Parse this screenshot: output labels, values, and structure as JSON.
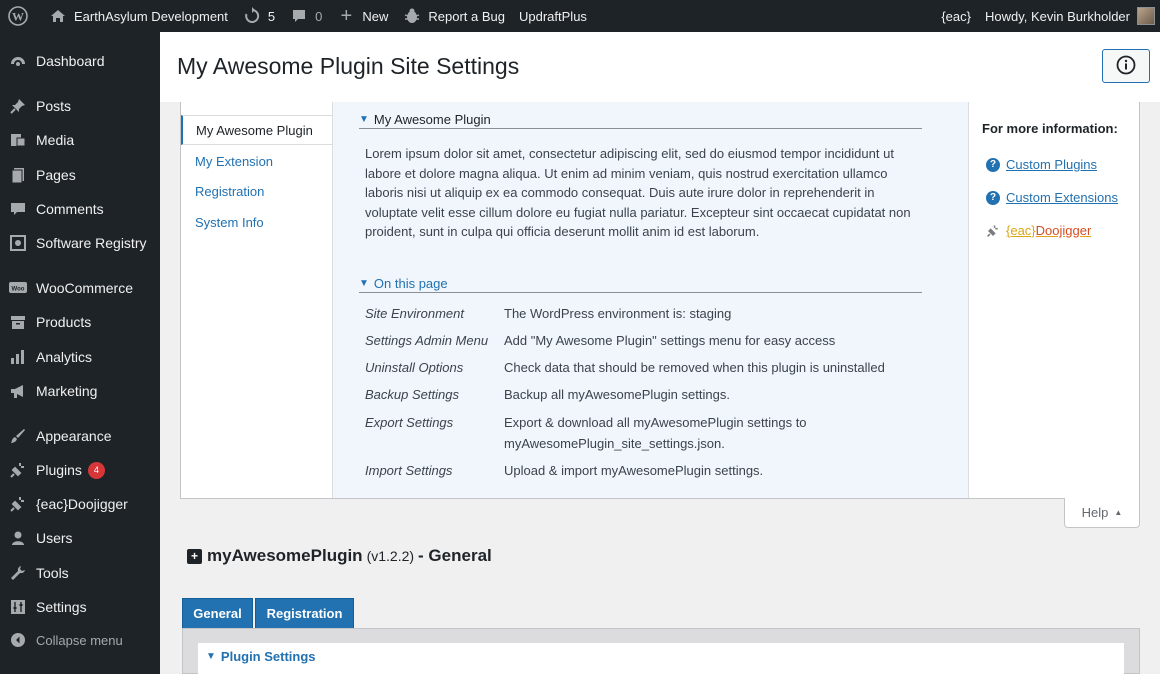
{
  "adminbar": {
    "site_name": "EarthAsylum Development",
    "updates_count": "5",
    "comments_count": "0",
    "new_label": "New",
    "report_bug": "Report a Bug",
    "updraft": "UpdraftPlus",
    "eac_label": "{eac}",
    "howdy": "Howdy, Kevin Burkholder"
  },
  "sidebar": {
    "items": [
      {
        "label": "Dashboard",
        "icon": "dashboard-icon"
      },
      {
        "label": "Posts",
        "icon": "pin-icon"
      },
      {
        "label": "Media",
        "icon": "media-icon"
      },
      {
        "label": "Pages",
        "icon": "pages-icon"
      },
      {
        "label": "Comments",
        "icon": "comment-icon"
      },
      {
        "label": "Software Registry",
        "icon": "registry-icon"
      },
      {
        "label": "WooCommerce",
        "icon": "woo-icon"
      },
      {
        "label": "Products",
        "icon": "archive-icon"
      },
      {
        "label": "Analytics",
        "icon": "chart-bar-icon"
      },
      {
        "label": "Marketing",
        "icon": "megaphone-icon"
      },
      {
        "label": "Appearance",
        "icon": "brush-icon"
      },
      {
        "label": "Plugins",
        "icon": "plug-icon",
        "badge": "4"
      },
      {
        "label": "{eac}Doojigger",
        "icon": "plug-icon"
      },
      {
        "label": "Users",
        "icon": "user-icon"
      },
      {
        "label": "Tools",
        "icon": "wrench-icon"
      },
      {
        "label": "Settings",
        "icon": "sliders-icon"
      }
    ],
    "collapse": "Collapse menu"
  },
  "page": {
    "title": "My Awesome Plugin Site Settings"
  },
  "help": {
    "tabs": [
      "My Awesome Plugin",
      "My Extension",
      "Registration",
      "System Info"
    ],
    "active_tab": "My Awesome Plugin",
    "section_title": "My Awesome Plugin",
    "lorem": "Lorem ipsum dolor sit amet, consectetur adipiscing elit, sed do eiusmod tempor incididunt ut labore et dolore magna aliqua. Ut enim ad minim veniam, quis nostrud exercitation ullamco laboris nisi ut aliquip ex ea commodo consequat. Duis aute irure dolor in reprehenderit in voluptate velit esse cillum dolore eu fugiat nulla pariatur. Excepteur sint occaecat cupidatat non proident, sunt in culpa qui officia deserunt mollit anim id est laborum.",
    "on_this_page": "On this page",
    "rows": [
      {
        "key": "Site Environment",
        "value": "The WordPress environment is: staging"
      },
      {
        "key": "Settings Admin Menu",
        "value": "Add \"My Awesome Plugin\" settings menu for easy access"
      },
      {
        "key": "Uninstall Options",
        "value": "Check data that should be removed when this plugin is uninstalled"
      },
      {
        "key": "Backup Settings",
        "value": "Backup all myAwesomePlugin settings."
      },
      {
        "key": "Export Settings",
        "value": "Export & download all myAwesomePlugin settings to myAwesomePlugin_site_settings.json."
      },
      {
        "key": "Import Settings",
        "value": "Upload & import myAwesomePlugin settings."
      }
    ],
    "more_info_title": "For more information:",
    "links": {
      "custom_plugins": "Custom Plugins",
      "custom_extensions": "Custom Extensions",
      "eac_prefix": "{eac}",
      "eac_name": "Doojigger"
    },
    "toggle_label": "Help"
  },
  "plugin": {
    "name": "myAwesomePlugin",
    "version": "(v1.2.2)",
    "section": "- General"
  },
  "tabs": [
    "General",
    "Registration"
  ],
  "settings": {
    "heading": "Plugin Settings"
  }
}
